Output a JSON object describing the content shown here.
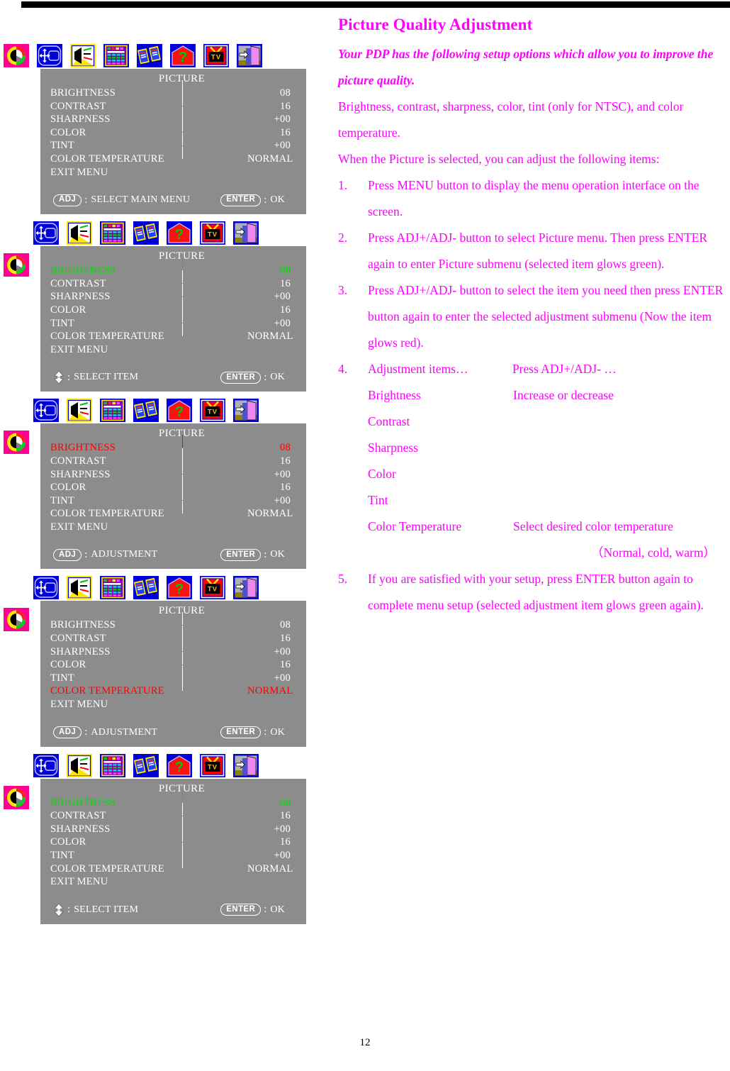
{
  "document": {
    "page_number": "12",
    "title": "Picture Quality Adjustment",
    "lead": "Your PDP has the following setup options which allow you to improve the picture quality.",
    "paragraphs": [
      "Brightness, contrast, sharpness, color, tint (only for NTSC), and color temperature.",
      "When the Picture is selected, you can adjust the following items:"
    ],
    "steps": [
      {
        "num": "1.",
        "text": "Press MENU button to display the menu operation interface on the screen."
      },
      {
        "num": "2.",
        "text": "Press ADJ+/ADJ- button to select Picture menu. Then press ENTER again to enter Picture submenu (selected item glows green)."
      },
      {
        "num": "3.",
        "text": "Press ADJ+/ADJ- button to select the item you need then press ENTER button again to enter the selected adjustment submenu (Now the item glows red)."
      },
      {
        "num": "4.",
        "text": "Adjustment items…"
      },
      {
        "num": "5.",
        "text": "If you are satisfied with your setup, press ENTER button again to complete menu setup (selected adjustment item glows green again)."
      }
    ],
    "step4_header_right": "Press ADJ+/ADJ- …",
    "step4_rows": [
      {
        "item": "Brightness",
        "desc": "Increase or decrease"
      },
      {
        "item": "Contrast",
        "desc": ""
      },
      {
        "item": "Sharpness",
        "desc": ""
      },
      {
        "item": "Color",
        "desc": ""
      },
      {
        "item": "Tint",
        "desc": ""
      },
      {
        "item": "Color Temperature",
        "desc": "Select desired color temperature"
      },
      {
        "item": "",
        "desc": "（Normal, cold, warm）"
      }
    ],
    "text_color": "#ff00ff"
  },
  "osd": {
    "panel_bg": "#8c8c8c",
    "highlight_green": "#00e000",
    "highlight_red": "#ff0000",
    "menu_title": "PICTURE",
    "icons": [
      {
        "name": "picture-color-wheel-icon",
        "label": "PICTURE"
      },
      {
        "name": "position-geometry-icon",
        "label": "POSITION"
      },
      {
        "name": "audio-speaker-icon",
        "label": "SOUND"
      },
      {
        "name": "setup-calculator-icon",
        "label": "SETUP"
      },
      {
        "name": "osd-language-books-icon",
        "label": "LANGUAGE"
      },
      {
        "name": "help-question-icon",
        "label": "HELP"
      },
      {
        "name": "tv-channel-icon",
        "label": "TV"
      },
      {
        "name": "exit-door-icon",
        "label": "EXIT"
      }
    ],
    "items": [
      {
        "label": "BRIGHTNESS",
        "value": "08",
        "bar": 57,
        "has_bar": true
      },
      {
        "label": "CONTRAST",
        "value": "16",
        "bar": 97,
        "has_bar": true
      },
      {
        "label": "SHARPNESS",
        "value": "+00",
        "bar": 57,
        "has_bar": true
      },
      {
        "label": "COLOR",
        "value": "16",
        "bar": 57,
        "has_bar": true
      },
      {
        "label": "TINT",
        "value": "+00",
        "bar": 57,
        "has_bar": true
      },
      {
        "label": "COLOR TEMPERATURE",
        "value": "NORMAL",
        "bar": 0,
        "has_bar": false
      },
      {
        "label": "EXIT MENU",
        "value": "",
        "bar": 0,
        "has_bar": false
      }
    ],
    "buttons": {
      "adj": "ADJ",
      "enter": "ENTER",
      "colon": ":"
    },
    "panels": [
      {
        "id": "panel-1",
        "show_side_icon": false,
        "icon_offset": 0,
        "highlight_index": -1,
        "highlight_mode": "none",
        "footer_left_kind": "adj",
        "footer_left_text": "SELECT MAIN MENU",
        "footer_right_text": "OK"
      },
      {
        "id": "panel-2",
        "show_side_icon": true,
        "icon_offset": 1,
        "highlight_index": 0,
        "highlight_mode": "green",
        "footer_left_kind": "updown",
        "footer_left_text": "SELECT ITEM",
        "footer_right_text": "OK"
      },
      {
        "id": "panel-3",
        "show_side_icon": true,
        "icon_offset": 1,
        "highlight_index": 0,
        "highlight_mode": "red",
        "footer_left_kind": "adj",
        "footer_left_text": "ADJUSTMENT",
        "footer_right_text": "OK"
      },
      {
        "id": "panel-4",
        "show_side_icon": true,
        "icon_offset": 1,
        "highlight_index": 5,
        "highlight_mode": "red",
        "footer_left_kind": "adj",
        "footer_left_text": "ADJUSTMENT",
        "footer_right_text": "OK"
      },
      {
        "id": "panel-5",
        "show_side_icon": true,
        "icon_offset": 1,
        "highlight_index": 0,
        "highlight_mode": "green",
        "footer_left_kind": "updown",
        "footer_left_text": "SELECT ITEM",
        "footer_right_text": "OK"
      }
    ]
  }
}
